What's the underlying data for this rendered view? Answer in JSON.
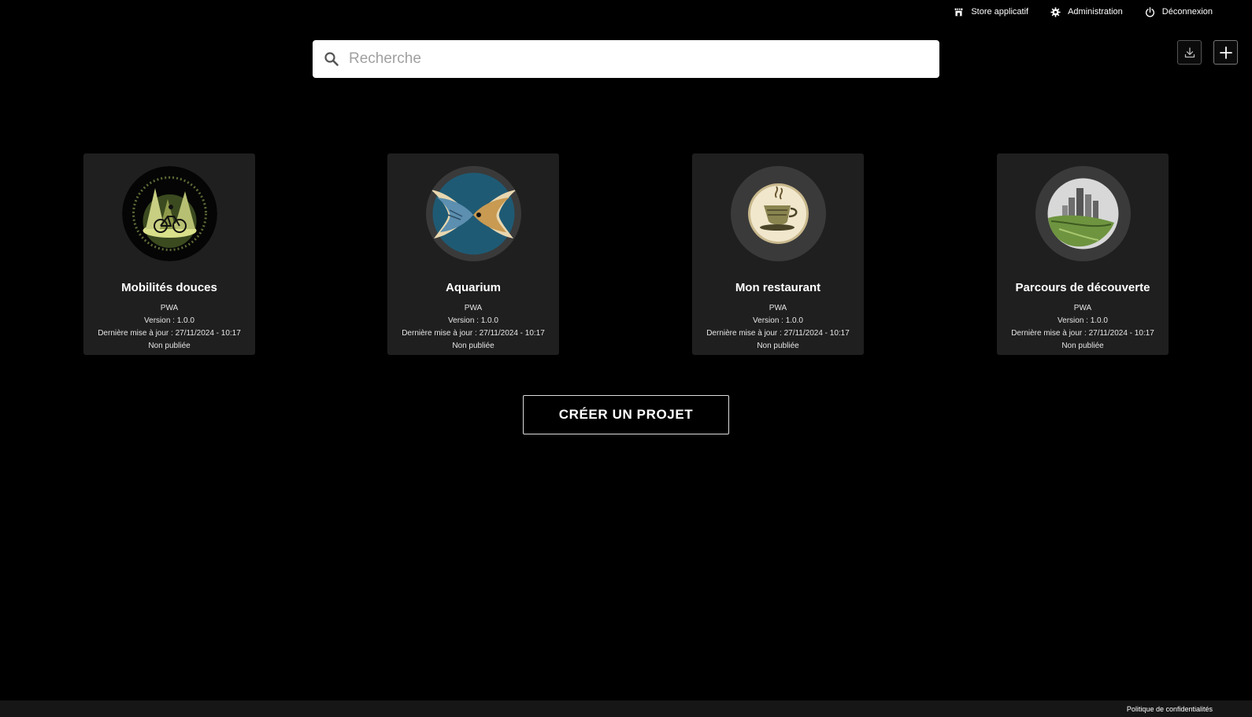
{
  "topnav": {
    "store": "Store applicatif",
    "admin": "Administration",
    "logout": "Déconnexion"
  },
  "search": {
    "placeholder": "Recherche"
  },
  "projects": [
    {
      "title": "Mobilités douces",
      "type": "PWA",
      "version": "Version : 1.0.0",
      "updated": "Dernière mise à jour : 27/11/2024 - 10:17",
      "status": "Non publiée",
      "icon": "bicycle-forest-logo"
    },
    {
      "title": "Aquarium",
      "type": "PWA",
      "version": "Version : 1.0.0",
      "updated": "Dernière mise à jour : 27/11/2024 - 10:17",
      "status": "Non publiée",
      "icon": "fish-logo"
    },
    {
      "title": "Mon restaurant",
      "type": "PWA",
      "version": "Version : 1.0.0",
      "updated": "Dernière mise à jour : 27/11/2024 - 10:17",
      "status": "Non publiée",
      "icon": "coffee-cup-logo"
    },
    {
      "title": "Parcours de découverte",
      "type": "PWA",
      "version": "Version : 1.0.0",
      "updated": "Dernière mise à jour : 27/11/2024 - 10:17",
      "status": "Non publiée",
      "icon": "city-leaf-logo"
    }
  ],
  "create_button": "CRÉER UN PROJET",
  "footer": {
    "privacy": "Politique de confidentialités"
  },
  "colors": {
    "background": "#000000",
    "card": "#1f1f1f",
    "footer": "#161616"
  }
}
